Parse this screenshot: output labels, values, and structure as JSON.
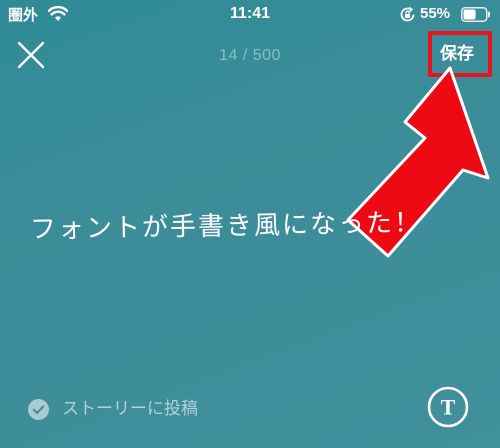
{
  "status_bar": {
    "carrier": "圏外",
    "wifi_icon": "wifi-icon",
    "time": "11:41",
    "rotation_lock_icon": "rotation-lock-icon",
    "battery_percent": "55%",
    "battery_level": 0.55
  },
  "top_bar": {
    "close_icon": "close-icon",
    "char_count": "14 / 500",
    "save_label": "保存"
  },
  "story": {
    "text": "フォントが手書き風になった！"
  },
  "bottom_bar": {
    "share_checked": true,
    "share_label": "ストーリーに投稿",
    "text_style_icon": "T"
  },
  "annotation": {
    "highlight_color": "#e8141b",
    "arrow_color": "#ee0a12"
  },
  "colors": {
    "background": "#3a8d98",
    "foreground": "#ffffff"
  }
}
